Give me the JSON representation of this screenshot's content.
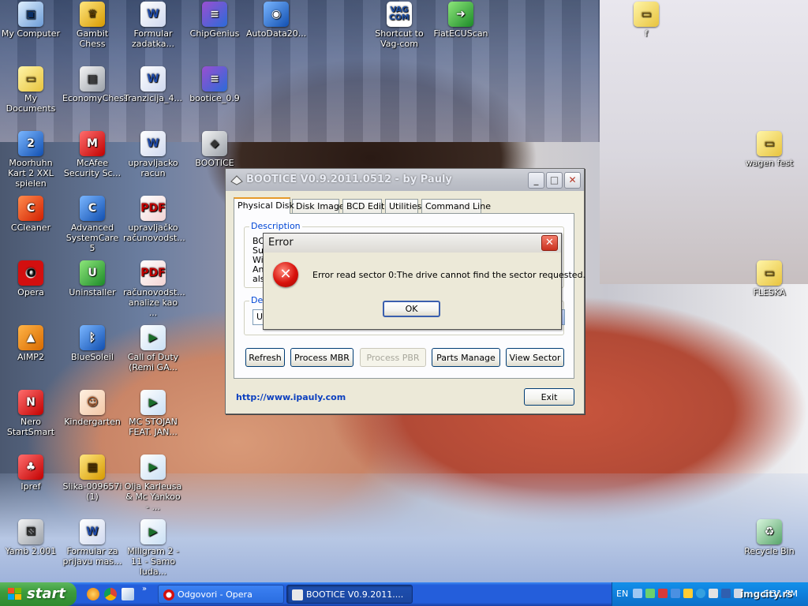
{
  "desktop": {
    "icons": [
      {
        "label": "My Computer",
        "glyph": "▣"
      },
      {
        "label": "Gambit Chess",
        "glyph": "♛"
      },
      {
        "label": "Formular zadatka...",
        "glyph": "W"
      },
      {
        "label": "ChipGenius",
        "glyph": "≡"
      },
      {
        "label": "AutoData20...",
        "glyph": "◉"
      },
      {
        "label": "Shortcut to Vag-com",
        "glyph": "VAG COM"
      },
      {
        "label": "FiatECUScan",
        "glyph": "➜"
      },
      {
        "label": "f",
        "glyph": "▭"
      },
      {
        "label": "My Documents",
        "glyph": "▭"
      },
      {
        "label": "EconomyChess",
        "glyph": "▤"
      },
      {
        "label": "Tranzicija_4...",
        "glyph": "W"
      },
      {
        "label": "bootice_0.9",
        "glyph": "≡"
      },
      {
        "label": "Moorhuhn Kart 2 XXL spielen",
        "glyph": "2"
      },
      {
        "label": "McAfee Security Sc...",
        "glyph": "M"
      },
      {
        "label": "upravljacko racun",
        "glyph": "W"
      },
      {
        "label": "BOOTICE",
        "glyph": "◆"
      },
      {
        "label": "wagen fest",
        "glyph": "▭"
      },
      {
        "label": "CCleaner",
        "glyph": "C"
      },
      {
        "label": "Advanced SystemCare 5",
        "glyph": "C"
      },
      {
        "label": "upravljačko računovodst...",
        "glyph": "PDF"
      },
      {
        "label": "Opera",
        "glyph": "O"
      },
      {
        "label": "Uninstaller",
        "glyph": "U"
      },
      {
        "label": "računovodst... analize kao ...",
        "glyph": "PDF"
      },
      {
        "label": "FLESKA",
        "glyph": "▭"
      },
      {
        "label": "AIMP2",
        "glyph": "▲"
      },
      {
        "label": "BlueSoleil",
        "glyph": "ᛒ"
      },
      {
        "label": "Call of Duty (Remi GA...",
        "glyph": "▶"
      },
      {
        "label": "Nero StartSmart",
        "glyph": "N"
      },
      {
        "label": "Kindergarten",
        "glyph": "☺"
      },
      {
        "label": "MC STOJAN FEAT. JAN...",
        "glyph": "▶"
      },
      {
        "label": "Ipref",
        "glyph": "♣"
      },
      {
        "label": "Slika-009657i (1)",
        "glyph": "▦"
      },
      {
        "label": "Olja Karleusa & Mc Yankoo - ...",
        "glyph": "▶"
      },
      {
        "label": "Yamb 2.001",
        "glyph": "⚄"
      },
      {
        "label": "Formular za prijavu mas...",
        "glyph": "W"
      },
      {
        "label": "Miligram 2 - 11 - Samo luda...",
        "glyph": "▶"
      },
      {
        "label": "Recycle Bin",
        "glyph": "♻"
      }
    ]
  },
  "bootice": {
    "title": "BOOTICE V0.9.2011.0512 - by Pauly",
    "tabs": [
      "Physical Disk",
      "Disk Image",
      "BCD Edit",
      "Utilities",
      "Command Line"
    ],
    "description_title": "Description",
    "description_lines": [
      "BO",
      "Su",
      "Wi",
      "An",
      "als"
    ],
    "destination_title": "Des",
    "combo_value": "US",
    "buttons": [
      "Refresh",
      "Process MBR",
      "Process PBR",
      "Parts Manage",
      "View Sector"
    ],
    "link": "http://www.ipauly.com",
    "exit": "Exit"
  },
  "error_dialog": {
    "title": "Error",
    "message": "Error read sector 0:The drive cannot find the sector requested.",
    "ok": "OK"
  },
  "taskbar": {
    "start": "start",
    "items": [
      "Odgovori - Opera",
      "BOOTICE V0.9.2011...."
    ],
    "lang": "EN",
    "clock": "6:31 PM"
  },
  "watermark": "imgcity.rs",
  "colors": {
    "taskbar_blue": "#245edb",
    "start_green": "#3c9c3c",
    "link_blue": "#0b3fbf",
    "error_red": "#d8120c"
  }
}
